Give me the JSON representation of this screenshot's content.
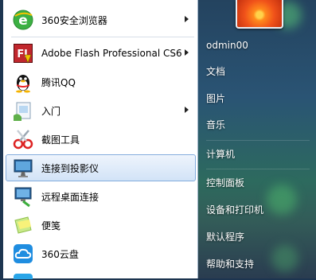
{
  "programs": [
    {
      "label": "360安全浏览器",
      "icon": "360-browser-icon",
      "submenu": true
    },
    {
      "label": "Adobe Flash Professional CS6",
      "icon": "flash-icon",
      "submenu": true,
      "icon_text": "Fl"
    },
    {
      "label": "腾讯QQ",
      "icon": "qq-penguin-icon",
      "submenu": false
    },
    {
      "label": "入门",
      "icon": "getting-started-icon",
      "submenu": true
    },
    {
      "label": "截图工具",
      "icon": "snipping-tool-icon",
      "submenu": false
    },
    {
      "label": "连接到投影仪",
      "icon": "projector-icon",
      "submenu": false,
      "highlighted": true
    },
    {
      "label": "远程桌面连接",
      "icon": "remote-desktop-icon",
      "submenu": false
    },
    {
      "label": "便笺",
      "icon": "sticky-notes-icon",
      "submenu": false
    },
    {
      "label": "360云盘",
      "icon": "360-cloud-icon",
      "submenu": false
    }
  ],
  "right_menu": {
    "user": "odmin00",
    "items": [
      "文档",
      "图片",
      "音乐",
      "计算机",
      "控制面板",
      "设备和打印机",
      "默认程序",
      "帮助和支持"
    ]
  },
  "colors": {
    "highlight_border": "#84acdd",
    "right_pane": "#2a5474",
    "browser_green": "#3cb043",
    "flash_red": "#c1272d"
  }
}
